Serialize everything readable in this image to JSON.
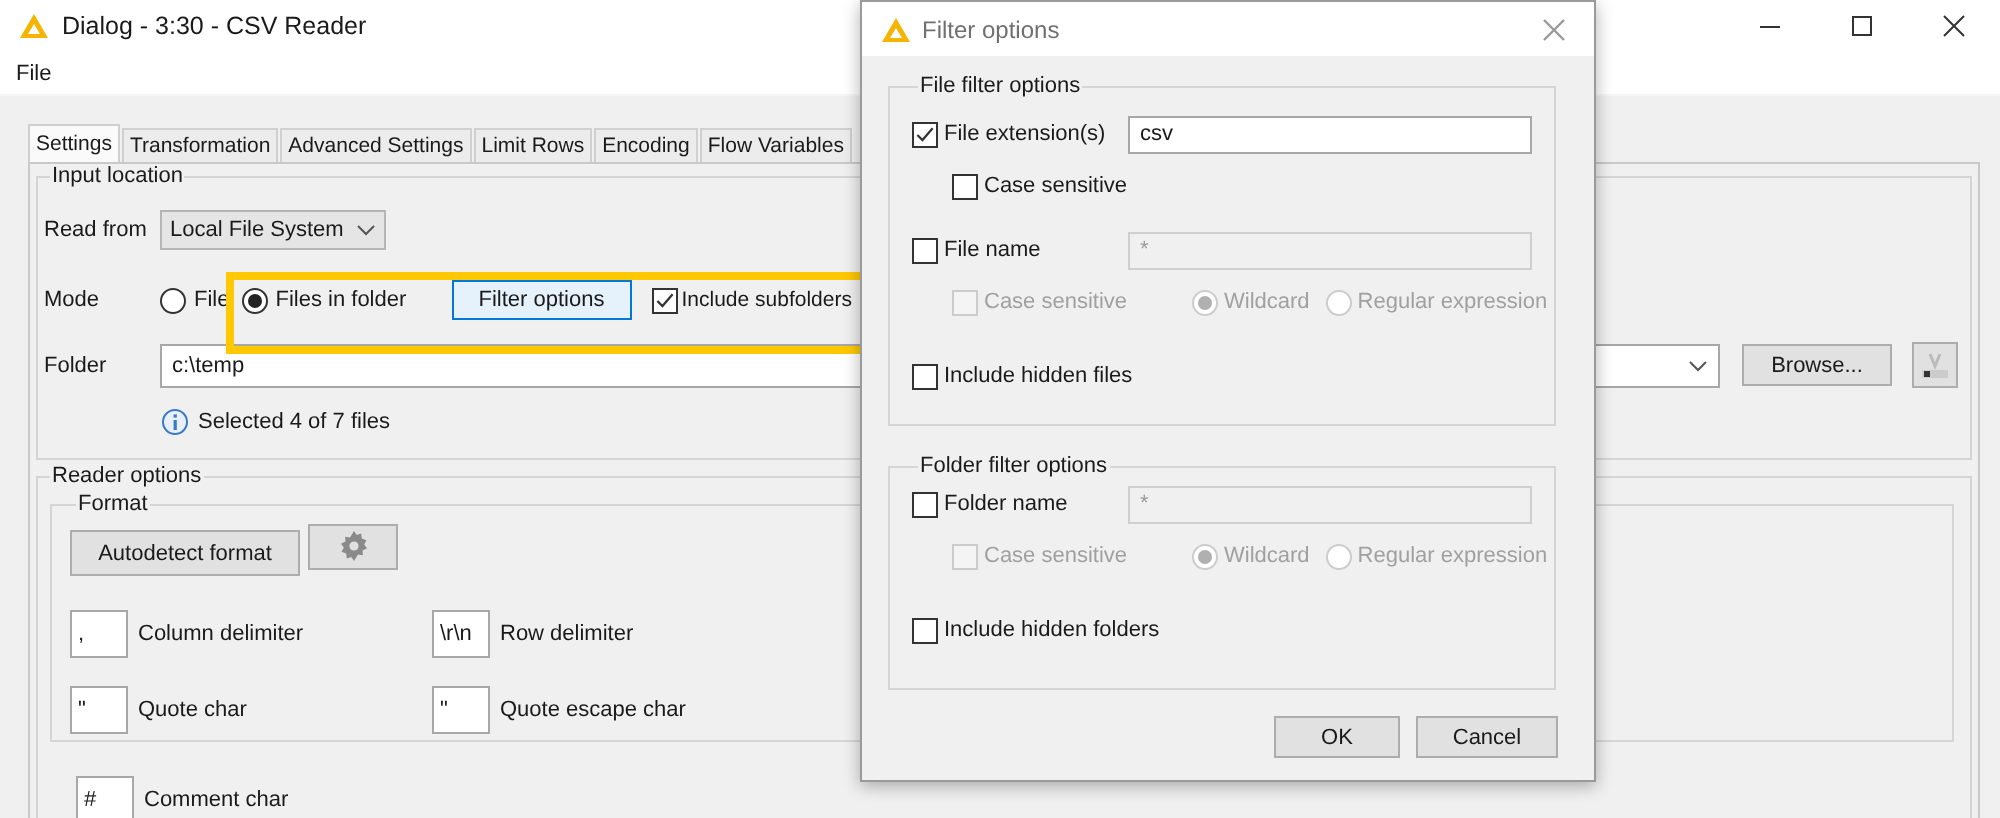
{
  "window": {
    "title": "Dialog - 3:30 - CSV Reader"
  },
  "menu": [
    "File"
  ],
  "tabs": [
    {
      "label": "Settings",
      "selected": true
    },
    {
      "label": "Transformation",
      "selected": false
    },
    {
      "label": "Advanced Settings",
      "selected": false
    },
    {
      "label": "Limit Rows",
      "selected": false
    },
    {
      "label": "Encoding",
      "selected": false
    },
    {
      "label": "Flow Variables",
      "selected": false
    }
  ],
  "input_location": {
    "title": "Input location",
    "read_from": {
      "label": "Read from",
      "value": "Local File System"
    },
    "mode": {
      "label": "Mode",
      "highlighted": true,
      "options": [
        {
          "label": "File",
          "selected": false
        },
        {
          "label": "Files in folder",
          "selected": true
        }
      ],
      "filter_button": "Filter options",
      "include_subfolders": {
        "label": "Include subfolders",
        "checked": true
      }
    },
    "folder": {
      "label": "Folder",
      "value": "c:\\temp",
      "browse": "Browse..."
    },
    "status": "Selected 4 of 7 files"
  },
  "reader_options": {
    "title": "Reader options",
    "format": {
      "title": "Format",
      "autodetect": "Autodetect format",
      "fields": [
        {
          "value": ",",
          "label": "Column delimiter"
        },
        {
          "value": "\\r\\n",
          "label": "Row delimiter"
        },
        {
          "value": "\"",
          "label": "Quote char"
        },
        {
          "value": "\"",
          "label": "Quote escape char"
        }
      ]
    },
    "comment": {
      "value": "#",
      "label": "Comment char"
    }
  },
  "filter_dialog": {
    "title": "Filter options",
    "groups": [
      {
        "title": "File filter options",
        "filters": [
          {
            "label": "File extension(s)",
            "checked": true,
            "field": {
              "value": "csv",
              "disabled": false
            },
            "case_sensitive": {
              "label": "Case sensitive",
              "checked": false,
              "disabled": false
            }
          },
          {
            "label": "File name",
            "checked": false,
            "field": {
              "value": "*",
              "disabled": true
            },
            "case_sensitive": {
              "label": "Case sensitive",
              "checked": false,
              "disabled": true
            },
            "match": [
              {
                "label": "Wildcard",
                "selected": true,
                "disabled": true
              },
              {
                "label": "Regular expression",
                "selected": false,
                "disabled": true
              }
            ]
          }
        ],
        "hidden": {
          "label": "Include hidden files",
          "checked": false
        }
      },
      {
        "title": "Folder filter options",
        "filters": [
          {
            "label": "Folder name",
            "checked": false,
            "field": {
              "value": "*",
              "disabled": true
            },
            "case_sensitive": {
              "label": "Case sensitive",
              "checked": false,
              "disabled": true
            },
            "match": [
              {
                "label": "Wildcard",
                "selected": true,
                "disabled": true
              },
              {
                "label": "Regular expression",
                "selected": false,
                "disabled": true
              }
            ]
          }
        ],
        "hidden": {
          "label": "Include hidden folders",
          "checked": false
        }
      }
    ],
    "buttons": [
      "OK",
      "Cancel"
    ]
  }
}
